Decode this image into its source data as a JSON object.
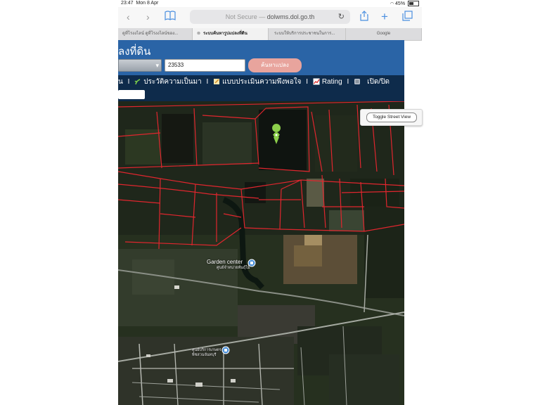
{
  "status_bar": {
    "time": "23:47",
    "date": "Mon 8 Apr",
    "battery": "45%"
  },
  "browser": {
    "url_prefix": "Not Secure —",
    "url_host": "dolwms.dol.go.th",
    "tabs": [
      {
        "label": "ดูที่โรงงไลน์ ดูที่โรงงไลน์ของ..."
      },
      {
        "label": "ระบบค้นหารูปแปลงที่ดิน",
        "active": true
      },
      {
        "label": "ระบบให้บริการประชาชนในการ..."
      },
      {
        "label": "Google"
      }
    ]
  },
  "site": {
    "title": "ลงที่ดิน",
    "parcel_value": "23533",
    "search_label": "ค้นหาแปลง",
    "menu": {
      "item0": "น",
      "item1": "ประวัติความเป็นมา",
      "item2": "แบบประเมินความพึงพอใจ",
      "item3": "Rating",
      "item4": "เปิด/ปิด"
    }
  },
  "map": {
    "toggle_street_view": "Toggle Street View",
    "poi_garden": "Garden center",
    "poi_garden_sub": "ศูนย์จำหน่ายพันธุ์ไม้",
    "poi_center_line1": "ศูนย์บริการเกษตร",
    "poi_center_line2": "พืชสวนจันทบุรี",
    "colors": {
      "parcel_line": "#e0262e",
      "header_blue": "#2a64a6",
      "menu_navy": "#0e2b4b",
      "pin_green": "#8ccf4b"
    }
  }
}
